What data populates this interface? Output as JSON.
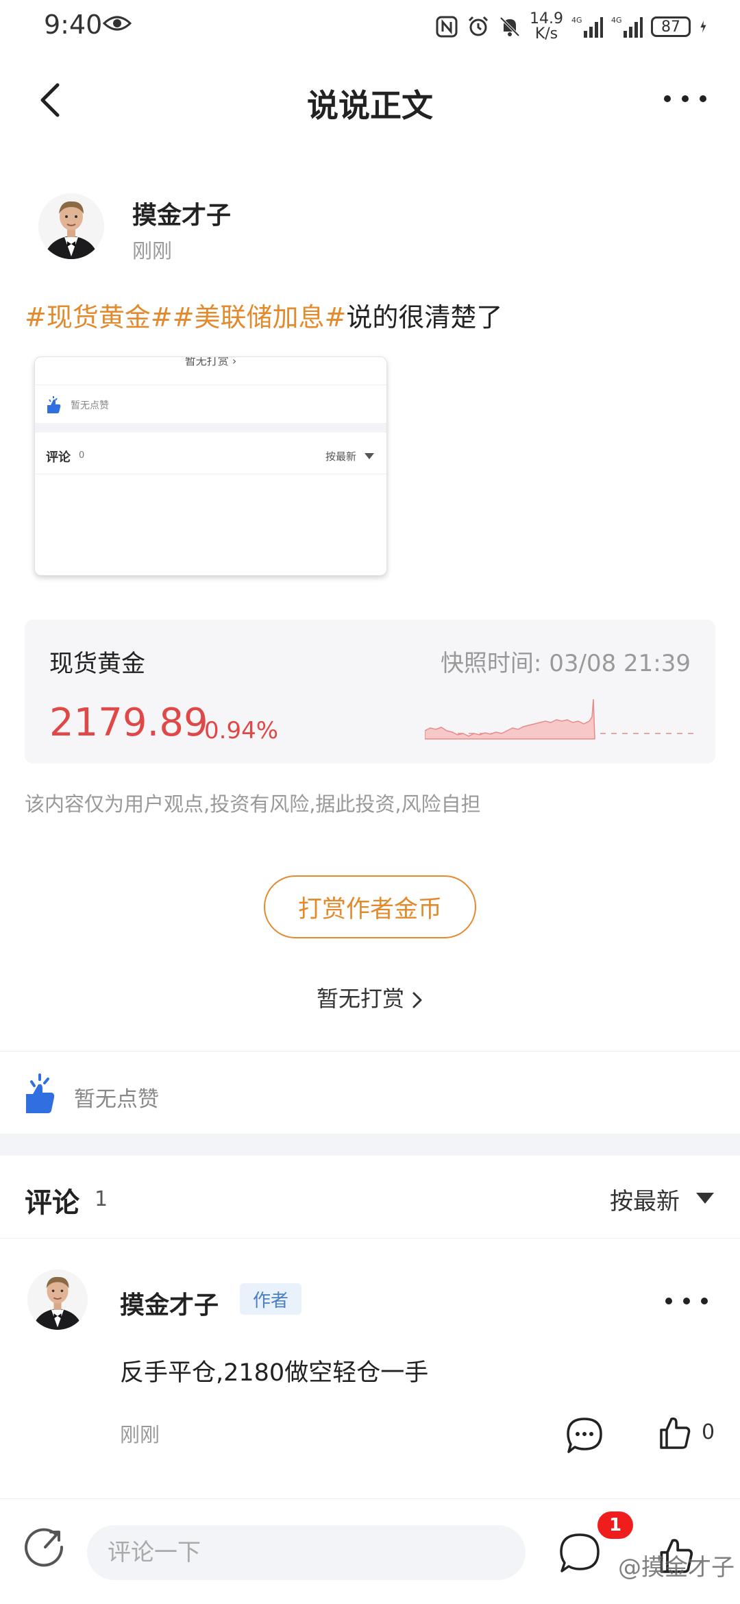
{
  "status_bar": {
    "time": "9:40",
    "speed_value": "14.9",
    "speed_unit": "K/s",
    "net_1": "4G",
    "net_2": "4G",
    "battery": "87"
  },
  "nav": {
    "title": "说说正文"
  },
  "post": {
    "author": "摸金才子",
    "time": "刚刚",
    "tags": [
      "#现货黄金#",
      "#美联储加息#"
    ],
    "text": "说的很清楚了"
  },
  "embedded_screenshot": {
    "top_text": "暂无打赏 ›",
    "like_text": "暂无点赞",
    "comment_label": "评论",
    "comment_count": "0",
    "sort_label": "按最新"
  },
  "quote": {
    "name": "现货黄金",
    "snapshot_label": "快照时间:",
    "snapshot_time": "03/08 21:39",
    "price": "2179.89",
    "change": "0.94%",
    "colors": {
      "up": "#e04848",
      "fill": "#f6c8c8"
    }
  },
  "disclaimer": "该内容仅为用户观点,投资有风险,据此投资,风险自担",
  "reward": {
    "button_label": "打赏作者金币",
    "none_label": "暂无打赏"
  },
  "likes": {
    "none_label": "暂无点赞"
  },
  "comments": {
    "title": "评论",
    "count": "1",
    "sort_label": "按最新",
    "items": [
      {
        "author": "摸金才子",
        "badge": "作者",
        "text": "反手平仓,2180做空轻仓一手",
        "time": "刚刚",
        "like_count": "0"
      }
    ]
  },
  "bottom_bar": {
    "input_placeholder": "评论一下",
    "comment_badge": "1",
    "watermark": "@摸金才子"
  },
  "colors": {
    "accent": "#e38a2c",
    "price_red": "#e04848",
    "author_badge": "#4a7fc4",
    "like_blue": "#2f6fe0"
  }
}
